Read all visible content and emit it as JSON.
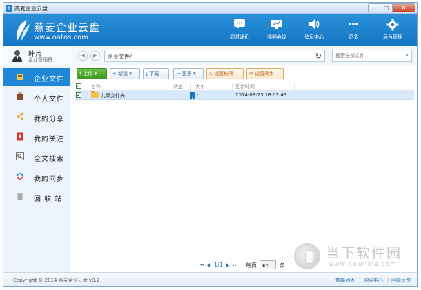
{
  "window": {
    "title": "燕麦企业云盘",
    "controls": {
      "minimize": "–",
      "maximize": "□",
      "close": "✕"
    }
  },
  "header": {
    "brand_name": "燕麦企业云盘",
    "brand_url": "www.oatos.com",
    "nav": [
      {
        "label": "即时通讯",
        "icon": "chat-icon"
      },
      {
        "label": "视频会议",
        "icon": "video-conference-icon"
      },
      {
        "label": "消息中心",
        "icon": "speaker-icon"
      },
      {
        "label": "更多",
        "icon": "more-icon"
      },
      {
        "label": "后台管理",
        "icon": "gear-icon"
      }
    ]
  },
  "user": {
    "name": "叶片",
    "role": "企业管理员"
  },
  "sidebar": {
    "items": [
      {
        "label": "企业文件",
        "icon": "enterprise-files-icon",
        "active": true
      },
      {
        "label": "个人文件",
        "icon": "briefcase-icon"
      },
      {
        "label": "我的分享",
        "icon": "share-icon"
      },
      {
        "label": "我的关注",
        "icon": "star-icon"
      },
      {
        "label": "全文搜索",
        "icon": "search-icon"
      },
      {
        "label": "我的同步",
        "icon": "sync-icon"
      },
      {
        "label": "回 收 站",
        "icon": "recycle-bin-icon"
      }
    ]
  },
  "address": {
    "path": "企业文件/",
    "search_placeholder": "搜索全部文件"
  },
  "toolbar": {
    "upload": "上传",
    "new": "新建",
    "download": "下载",
    "more": "更多",
    "set_permission": "设置权限",
    "set_sync": "设置同步"
  },
  "table": {
    "headers": {
      "name": "名称",
      "status": "状态",
      "size": "大小",
      "updated": "更新时间"
    },
    "rows": [
      {
        "name": "共享文件夹",
        "size": "-",
        "updated": "2014-09-23 18:02:43"
      }
    ]
  },
  "pager": {
    "page": "1/1",
    "per_page_label": "每页",
    "per_page_value": "30",
    "unit": "条"
  },
  "status": {
    "copyright": "Copyright © 2014 燕麦企业云盘 v3.2",
    "links": [
      "传输列表",
      "购买中心",
      "问题反馈"
    ]
  },
  "watermark": {
    "text": "当下软件园",
    "url": "www.downxia.com"
  },
  "colors": {
    "brand_blue": "#1f88d6",
    "upload_green": "#4aa62b",
    "accent_orange": "#e1a95c",
    "selected_row": "#d7e9fa"
  }
}
